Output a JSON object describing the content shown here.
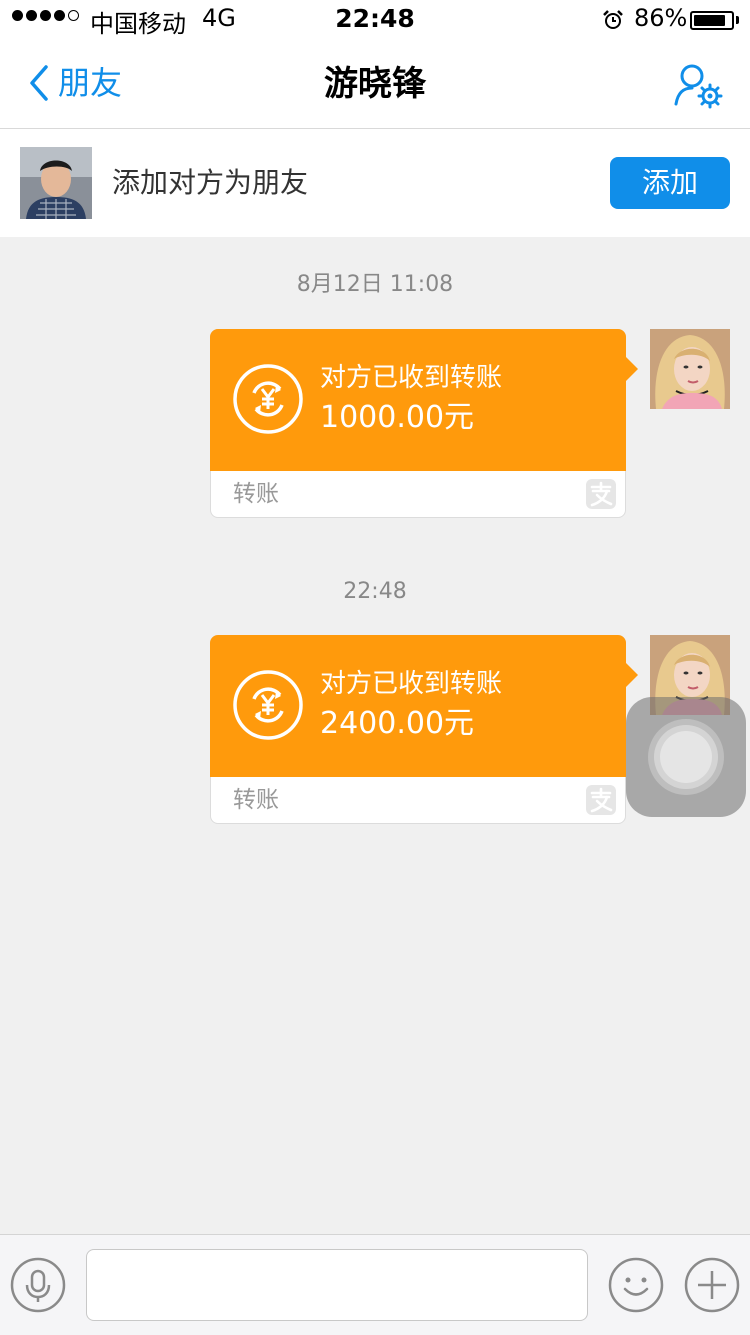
{
  "status_bar": {
    "carrier": "中国移动",
    "network": "4G",
    "time": "22:48",
    "battery_percent": "86%",
    "battery_level": 0.86,
    "signal_bars_filled": 4,
    "signal_bars_total": 5,
    "alarm_icon": "alarm-clock-icon"
  },
  "nav": {
    "back_label": "朋友",
    "title": "游晓锋",
    "settings_icon": "contact-settings-icon"
  },
  "add_friend": {
    "prompt": "添加对方为朋友",
    "button_label": "添加"
  },
  "messages": [
    {
      "timestamp": "8月12日 11:08",
      "status": "对方已收到转账",
      "amount": "1000.00元",
      "footer_label": "转账",
      "icon": "transfer-yuan-icon"
    },
    {
      "timestamp": "22:48",
      "status": "对方已收到转账",
      "amount": "2400.00元",
      "footer_label": "转账",
      "icon": "transfer-yuan-icon"
    }
  ],
  "input_bar": {
    "voice_icon": "microphone-icon",
    "input_value": "",
    "emoji_icon": "emoji-icon",
    "plus_icon": "plus-icon"
  },
  "colors": {
    "accent": "#108ee9",
    "transfer_orange": "#ff9a0c",
    "background": "#f0f0f0"
  }
}
